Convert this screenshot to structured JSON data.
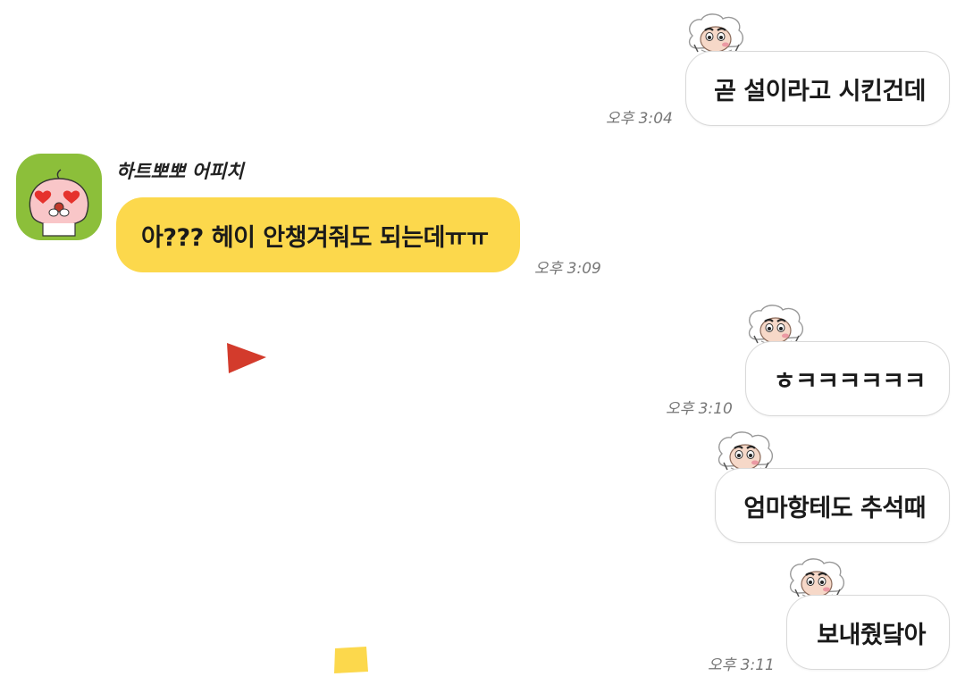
{
  "messages": [
    {
      "id": "m1",
      "direction": "out",
      "text": "곧 설이라고 시킨건데",
      "time": "오후 3:04"
    },
    {
      "id": "m2",
      "direction": "in",
      "sender": "하트뽀뽀 어피치",
      "text": "아??? 헤이 안챙겨줘도 되는데ㅠㅠ",
      "time": "오후 3:09"
    },
    {
      "id": "m3",
      "direction": "out",
      "text": "ㅎㅋㅋㅋㅋㅋㅋ",
      "time": "오후 3:10"
    },
    {
      "id": "m4",
      "direction": "out",
      "text": "엄마항테도 추석때",
      "time": ""
    },
    {
      "id": "m5",
      "direction": "out",
      "text": "보내줬닼아",
      "time": "오후 3:11"
    }
  ],
  "avatar": {
    "icon": "apeach-heart-eyes-icon",
    "bg_color": "#8cbf3a"
  },
  "sticker": {
    "icon": "sheep-character-icon"
  },
  "decorations": [
    {
      "icon": "red-triangle-mark-icon",
      "color": "#d33b2c"
    },
    {
      "icon": "yellow-square-mark-icon",
      "color": "#fcd84c"
    }
  ],
  "colors": {
    "incoming_bubble": "#fcd84c",
    "outgoing_bubble": "#ffffff",
    "outgoing_border": "#d9d9d9",
    "timestamp": "#777777"
  }
}
